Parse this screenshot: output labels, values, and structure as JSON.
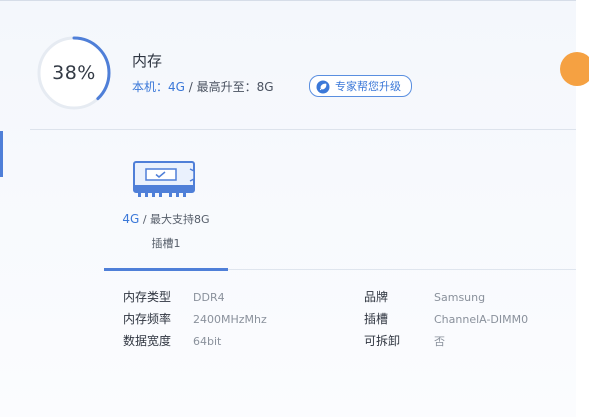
{
  "memory": {
    "usage_percent": 38,
    "usage_text": "38%",
    "title": "内存",
    "current_label": "本机：",
    "current_value": "4G",
    "separator": " / ",
    "max_label": "最高升至：",
    "max_value": "8G",
    "upgrade_button": "专家帮您升级",
    "accent_color": "#4f7fd8"
  },
  "slots": [
    {
      "size": "4G",
      "max_support": " / 最大支持8G",
      "name": "插槽1",
      "icon": "memory-stick-icon"
    }
  ],
  "details": {
    "left": [
      {
        "label": "内存类型",
        "value": "DDR4"
      },
      {
        "label": "内存频率",
        "value": "2400MHzMhz"
      },
      {
        "label": "数据宽度",
        "value": "64bit"
      }
    ],
    "right": [
      {
        "label": "品牌",
        "value": "Samsung"
      },
      {
        "label": "插槽",
        "value": "ChannelA-DIMM0"
      },
      {
        "label": "可拆卸",
        "value": "否"
      }
    ]
  }
}
